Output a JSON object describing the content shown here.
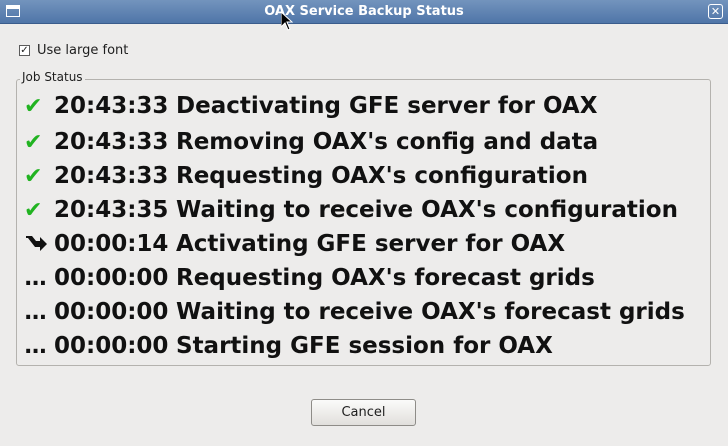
{
  "window": {
    "title": "OAX Service Backup Status",
    "close_glyph": "✕"
  },
  "options": {
    "large_font_label": "Use large font",
    "large_font_checked": true
  },
  "job_status": {
    "group_label": "Job Status",
    "jobs": [
      {
        "status": "done",
        "icon": "check-icon",
        "time": "20:43:33",
        "description": "Deactivating GFE server for OAX"
      },
      {
        "status": "done",
        "icon": "check-icon",
        "time": "20:43:33",
        "description": "Removing OAX's config and data"
      },
      {
        "status": "done",
        "icon": "check-icon",
        "time": "20:43:33",
        "description": "Requesting OAX's configuration"
      },
      {
        "status": "done",
        "icon": "check-icon",
        "time": "20:43:35",
        "description": "Waiting to receive OAX's configuration"
      },
      {
        "status": "running",
        "icon": "arrow-icon",
        "time": "00:00:14",
        "description": "Activating GFE server for OAX"
      },
      {
        "status": "pending",
        "icon": "ellipsis-icon",
        "time": "00:00:00",
        "description": "Requesting OAX's forecast grids"
      },
      {
        "status": "pending",
        "icon": "ellipsis-icon",
        "time": "00:00:00",
        "description": "Waiting to receive OAX's forecast grids"
      },
      {
        "status": "pending",
        "icon": "ellipsis-icon",
        "time": "00:00:00",
        "description": "Starting GFE session for OAX"
      }
    ]
  },
  "footer": {
    "cancel_label": "Cancel"
  },
  "colors": {
    "titlebar": "#5b80b2",
    "check": "#21b321",
    "background": "#edeceb"
  }
}
